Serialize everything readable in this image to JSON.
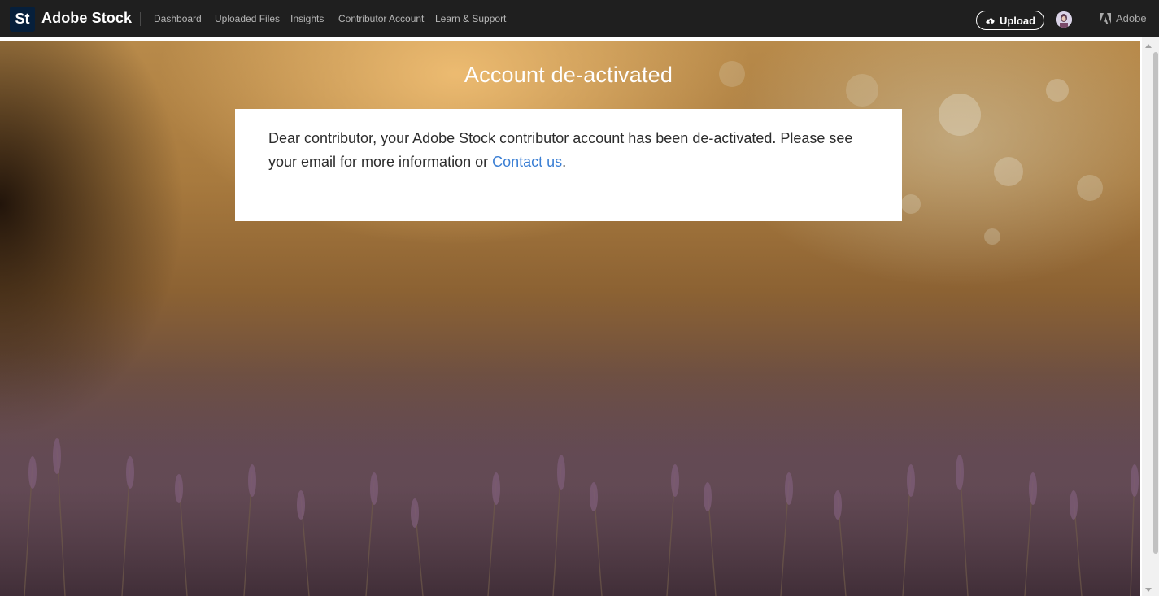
{
  "header": {
    "logo_badge": "St",
    "brand": "Adobe Stock",
    "nav": [
      {
        "label": "Dashboard"
      },
      {
        "label": "Uploaded Files"
      },
      {
        "label": "Insights"
      },
      {
        "label": "Contributor Account"
      },
      {
        "label": "Learn & Support"
      }
    ],
    "upload_label": "Upload",
    "adobe_label": "Adobe"
  },
  "main": {
    "title": "Account de-activated",
    "message_text": "Dear contributor, your Adobe Stock contributor account has been de-activated. Please see your email for more information or ",
    "message_link": "Contact us",
    "message_end": "."
  },
  "colors": {
    "topbar": "#1f1f1f",
    "logo_badge": "#061f3b",
    "link": "#3b7fd4"
  },
  "icons": {
    "upload": "cloud-upload-icon",
    "adobe": "adobe-logo-icon"
  }
}
